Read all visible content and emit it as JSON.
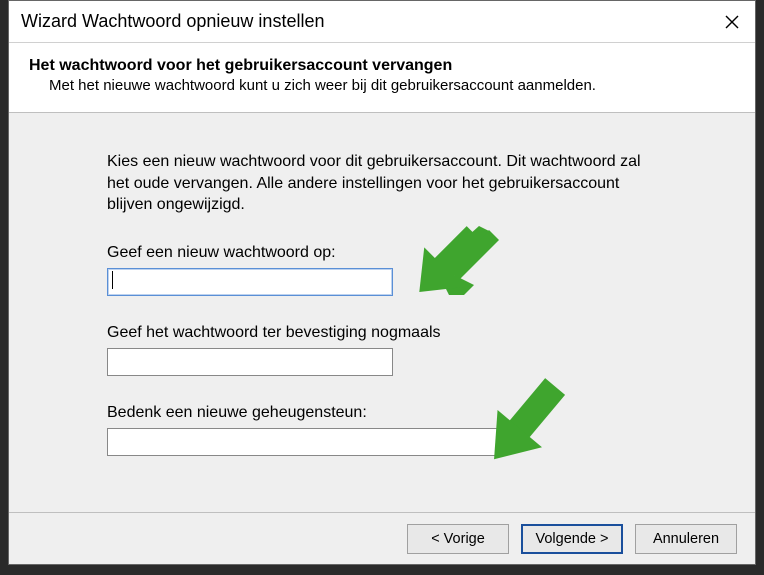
{
  "titlebar": {
    "title": "Wizard Wachtwoord opnieuw instellen"
  },
  "header": {
    "heading": "Het wachtwoord voor het gebruikersaccount vervangen",
    "sub": "Met het nieuwe wachtwoord kunt u zich weer bij dit gebruikersaccount aanmelden."
  },
  "content": {
    "intro": "Kies een nieuw wachtwoord voor dit gebruikersaccount. Dit wachtwoord zal het oude vervangen. Alle andere instellingen voor het gebruikersaccount blijven ongewijzigd.",
    "label_new": "Geef een nieuw wachtwoord op:",
    "value_new": "",
    "label_confirm": "Geef het wachtwoord ter bevestiging nogmaals",
    "value_confirm": "",
    "label_hint": "Bedenk een nieuwe geheugensteun:",
    "value_hint": ""
  },
  "buttons": {
    "back": "< Vorige",
    "next": "Volgende >",
    "cancel": "Annuleren"
  }
}
